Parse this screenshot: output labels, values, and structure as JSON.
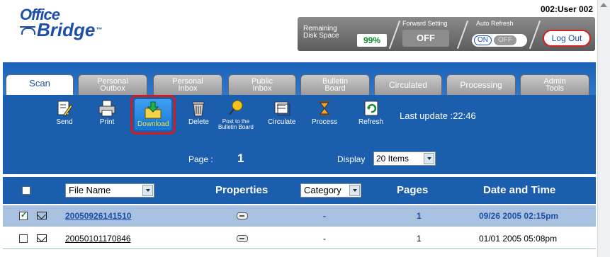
{
  "header": {
    "logo_line1": "Office",
    "logo_line2": "Bridge",
    "logo_tm": "™",
    "user": "002:User 002",
    "disk_label": "Remaining Disk Space",
    "disk_value": "99%",
    "forward_label": "Forward Setting",
    "forward_value": "OFF",
    "auto_refresh_label": "Auto Refresh",
    "auto_refresh_on": "ON",
    "auto_refresh_off": "OFF",
    "logout_label": "Log Out"
  },
  "tabs": [
    {
      "line1": "Scan",
      "line2": ""
    },
    {
      "line1": "Personal",
      "line2": "Outbox"
    },
    {
      "line1": "Personal",
      "line2": "Inbox"
    },
    {
      "line1": "Public",
      "line2": "Inbox"
    },
    {
      "line1": "Bulletin",
      "line2": "Board"
    },
    {
      "line1": "Circulated",
      "line2": ""
    },
    {
      "line1": "Processing",
      "line2": ""
    },
    {
      "line1": "Admin",
      "line2": "Tools"
    }
  ],
  "toolbar": {
    "send": "Send",
    "print": "Print",
    "download": "Download",
    "delete": "Delete",
    "post_line1": "Post to the",
    "post_line2": "Bulletin Board",
    "circulate": "Circulate",
    "process": "Process",
    "refresh": "Refresh",
    "last_update": "Last update :22:46",
    "page_label": "Page :",
    "page_number": "1",
    "display_label": "Display",
    "display_value": "20 Items"
  },
  "table": {
    "filename_select": "File Name",
    "properties": "Properties",
    "category_select": "Category",
    "pages": "Pages",
    "date_time": "Date and Time",
    "rows": [
      {
        "checked": true,
        "name": "20050926141510",
        "category": "-",
        "pages": "1",
        "date": "09/26 2005 02:15pm"
      },
      {
        "checked": false,
        "name": "20050101170846",
        "category": "-",
        "pages": "1",
        "date": "01/01 2005 05:08pm"
      }
    ]
  },
  "colors": {
    "brand_blue": "#1b5eae",
    "highlight_red": "#d01c1c",
    "selected_row": "#a9c1e0"
  }
}
